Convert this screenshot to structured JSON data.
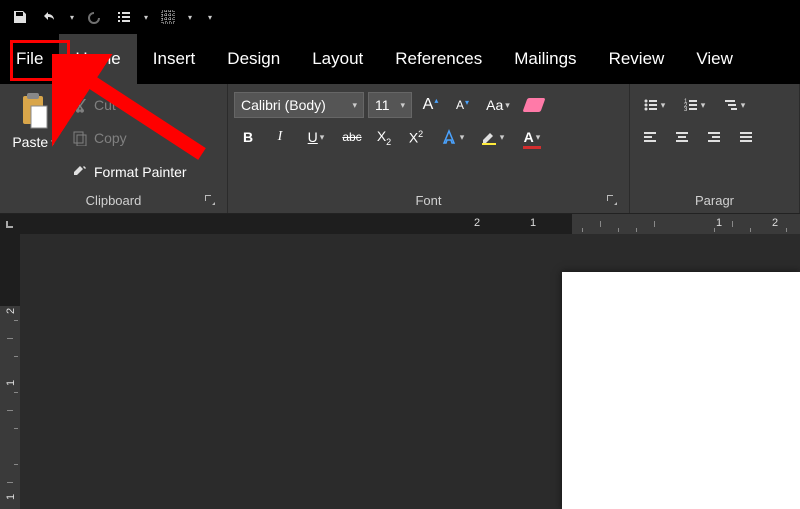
{
  "qat": {
    "save": "save-icon",
    "undo": "undo-icon",
    "redo": "redo-icon",
    "list": "list-icon",
    "grid": "grid-icon"
  },
  "tabs": {
    "file": "File",
    "home": "Home",
    "insert": "Insert",
    "design": "Design",
    "layout": "Layout",
    "references": "References",
    "mailings": "Mailings",
    "review": "Review",
    "view": "View",
    "active": "home",
    "highlighted": "file"
  },
  "ribbon": {
    "clipboard": {
      "label": "Clipboard",
      "paste": "Paste",
      "cut": "Cut",
      "copy": "Copy",
      "format_painter": "Format Painter"
    },
    "font": {
      "label": "Font",
      "name": "Calibri (Body)",
      "size": "11",
      "change_case": "Aa",
      "bold": "B",
      "italic": "I",
      "underline": "U",
      "strike": "abc",
      "subscript": "X",
      "superscript": "X"
    },
    "paragraph": {
      "label": "Paragr"
    }
  },
  "ruler": {
    "h": [
      "2",
      "1",
      "1",
      "2"
    ],
    "v": [
      "2",
      "1",
      "1"
    ]
  },
  "annotation": {
    "target": "file-tab",
    "type": "red-arrow"
  }
}
